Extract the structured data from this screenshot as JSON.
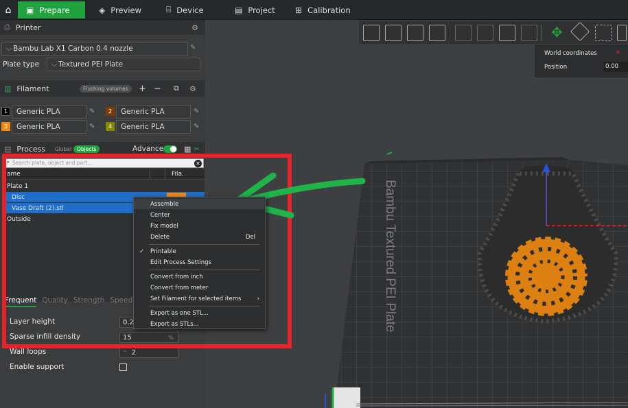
{
  "topbar": {
    "tabs": [
      {
        "label": "Prepare",
        "icon": "cube-icon"
      },
      {
        "label": "Preview",
        "icon": "layers-icon"
      },
      {
        "label": "Device",
        "icon": "device-icon"
      },
      {
        "label": "Project",
        "icon": "project-icon"
      },
      {
        "label": "Calibration",
        "icon": "calibration-icon"
      }
    ]
  },
  "printer": {
    "section_title": "Printer",
    "printer_name": "Bambu Lab X1 Carbon 0.4 nozzle",
    "plate_type_label": "Plate type",
    "plate_type_value": "Textured PEI Plate"
  },
  "filament": {
    "section_title": "Filament",
    "flushing_label": "Flushing volumes",
    "items": [
      {
        "num": "1",
        "name": "Generic PLA",
        "color": "#000000"
      },
      {
        "num": "2",
        "name": "Generic PLA",
        "color": "#7a3f00"
      },
      {
        "num": "3",
        "name": "Generic PLA",
        "color": "#f08a10"
      },
      {
        "num": "4",
        "name": "Generic PLA",
        "color": "#8a8a00"
      }
    ]
  },
  "process": {
    "section_title": "Process",
    "global_label": "Global",
    "objects_label": "Objects",
    "advance_label": "Advance"
  },
  "object_list": {
    "search_placeholder": "Search plate, object and part...",
    "col_name": "ame",
    "col_fila": "Fila.",
    "plate": "Plate 1",
    "items": [
      "Disc",
      "Vase Draft (2).stl"
    ],
    "outside": "Outside"
  },
  "context_menu": {
    "items": [
      "Assemble",
      "Center",
      "Fix model",
      "Delete",
      "Printable",
      "Edit Process Settings",
      "Convert from inch",
      "Convert from meter",
      "Set Filament for selected items",
      "Export as one STL...",
      "Export as STLs..."
    ],
    "delete_shortcut": "Del"
  },
  "settings_tabs": [
    "Frequent",
    "Quality",
    "Strength",
    "Speed"
  ],
  "properties": {
    "layer_height_label": "Layer height",
    "layer_height_value": "0.2",
    "sparse_infill_label": "Sparse infill density",
    "sparse_infill_value": "15",
    "sparse_infill_unit": "%",
    "wall_loops_label": "Wall loops",
    "wall_loops_value": "2",
    "enable_support_label": "Enable support"
  },
  "viewport": {
    "plate_label": "Bambu Textured PEI Plate",
    "world_coords_label": "World coordinates",
    "position_label": "Position",
    "position_value": "0.00"
  },
  "colors": {
    "accent": "#20a33e",
    "annotation_red": "#e8232b",
    "annotation_green": "#1fb34a",
    "selection": "#1f6fc9",
    "print_orange": "#f08a10"
  }
}
